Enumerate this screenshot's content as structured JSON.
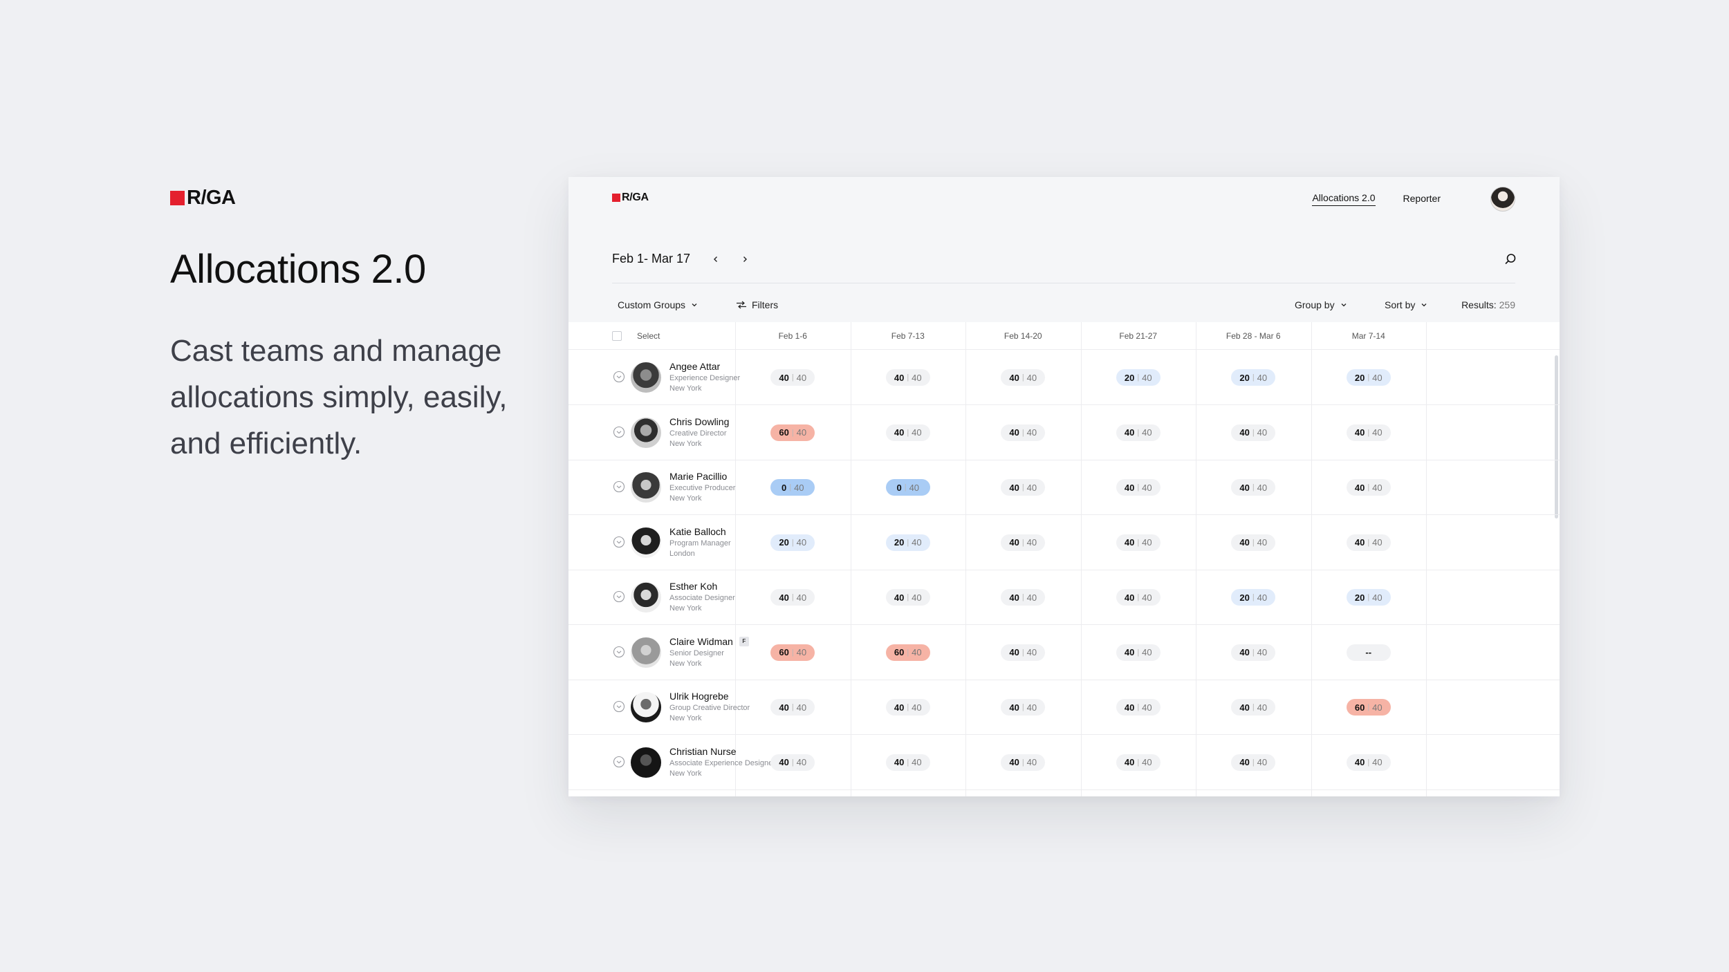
{
  "brand": {
    "text": "R/GA",
    "color": "#e4202e"
  },
  "hero": {
    "title": "Allocations 2.0",
    "description": "Cast teams and manage allocations simply, easily, and efficiently."
  },
  "app": {
    "brand": "R/GA",
    "nav": [
      {
        "label": "Allocations 2.0",
        "active": true
      },
      {
        "label": "Reporter",
        "active": false
      }
    ],
    "date_range": "Feb 1- Mar 17",
    "toolbar": {
      "custom_groups": "Custom Groups",
      "filters": "Filters",
      "group_by": "Group by",
      "sort_by": "Sort by",
      "results_label": "Results:",
      "results_count": "259"
    },
    "table": {
      "select_label": "Select",
      "weeks": [
        "Feb 1-6",
        "Feb 7-13",
        "Feb 14-20",
        "Feb 21-27",
        "Feb 28 - Mar 6",
        "Mar 7-14"
      ],
      "capacity": "40",
      "rows": [
        {
          "name": "Angee Attar",
          "title": "Experience Designer",
          "location": "New York",
          "flag": "",
          "alloc": [
            "40",
            "40",
            "40",
            "20",
            "20",
            "20"
          ]
        },
        {
          "name": "Chris Dowling",
          "title": "Creative Director",
          "location": "New York",
          "flag": "",
          "alloc": [
            "60",
            "40",
            "40",
            "40",
            "40",
            "40"
          ]
        },
        {
          "name": "Marie Pacillio",
          "title": "Executive Producer",
          "location": "New York",
          "flag": "",
          "alloc": [
            "0",
            "0",
            "40",
            "40",
            "40",
            "40"
          ]
        },
        {
          "name": "Katie Balloch",
          "title": "Program Manager",
          "location": "London",
          "flag": "",
          "alloc": [
            "20",
            "20",
            "40",
            "40",
            "40",
            "40"
          ]
        },
        {
          "name": "Esther Koh",
          "title": "Associate Designer",
          "location": "New York",
          "flag": "",
          "alloc": [
            "40",
            "40",
            "40",
            "40",
            "20",
            "20"
          ]
        },
        {
          "name": "Claire Widman",
          "title": "Senior Designer",
          "location": "New York",
          "flag": "F",
          "alloc": [
            "60",
            "60",
            "40",
            "40",
            "40",
            "--"
          ]
        },
        {
          "name": "Ulrik Hogrebe",
          "title": "Group Creative Director",
          "location": "New York",
          "flag": "",
          "alloc": [
            "40",
            "40",
            "40",
            "40",
            "40",
            "60"
          ]
        },
        {
          "name": "Christian Nurse",
          "title": "Associate Experience Designer",
          "location": "New York",
          "flag": "",
          "alloc": [
            "40",
            "40",
            "40",
            "40",
            "40",
            "40"
          ]
        }
      ]
    },
    "status_colors": {
      "full": "#f1f2f4",
      "under": "#e1ecfb",
      "zero": "#a9ccf5",
      "over": "#f6b3a5"
    }
  }
}
